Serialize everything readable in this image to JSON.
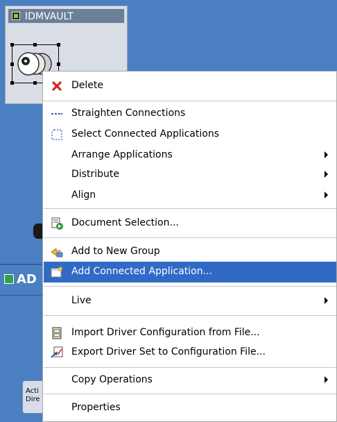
{
  "vault": {
    "title": "IDMVAULT"
  },
  "sidebar": {
    "label": "AD",
    "tile_line1": "Acti",
    "tile_line2": "Dire"
  },
  "context_menu": {
    "items": [
      {
        "label": "Delete",
        "icon": "delete-icon"
      },
      {
        "label": "Straighten Connections",
        "icon": "straighten-connections-icon"
      },
      {
        "label": "Select Connected Applications",
        "icon": "select-connected-icon"
      },
      {
        "label": "Arrange Applications",
        "submenu": true
      },
      {
        "label": "Distribute",
        "submenu": true
      },
      {
        "label": "Align",
        "submenu": true
      },
      {
        "label": "Document Selection...",
        "icon": "document-selection-icon"
      },
      {
        "label": "Add to New Group",
        "icon": "add-to-group-icon"
      },
      {
        "label": "Add Connected Application...",
        "icon": "add-connected-app-icon",
        "highlighted": true
      },
      {
        "label": "Live",
        "submenu": true
      },
      {
        "label": "Import Driver Configuration from File...",
        "icon": "import-config-icon"
      },
      {
        "label": "Export Driver Set to Configuration File...",
        "icon": "export-config-icon"
      },
      {
        "label": "Copy Operations",
        "submenu": true
      },
      {
        "label": "Properties"
      }
    ]
  },
  "colors": {
    "desktop_bg": "#4a7fc1",
    "menu_highlight": "#316ac5",
    "vault_title_bg": "#6a7f98"
  }
}
